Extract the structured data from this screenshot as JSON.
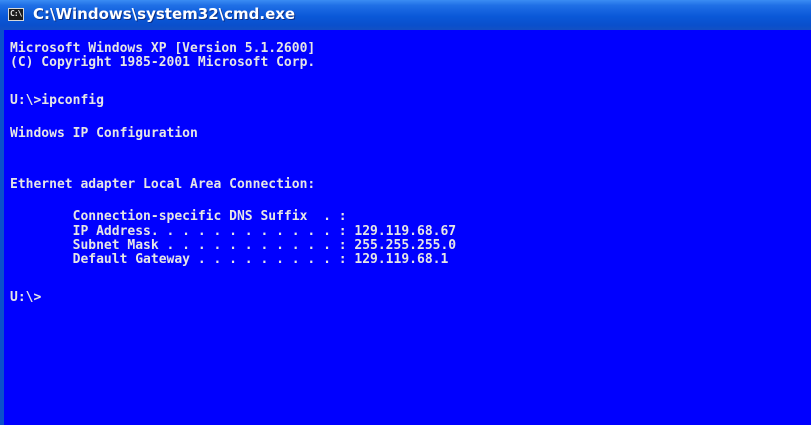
{
  "window": {
    "title": "C:\\Windows\\system32\\cmd.exe",
    "icon": "cmd-icon",
    "icon_text": "C:\\"
  },
  "console": {
    "lines": [
      "Microsoft Windows XP [Version 5.1.2600]",
      "(C) Copyright 1985-2001 Microsoft Corp.",
      "U:\\>ipconfig",
      "Windows IP Configuration",
      "Ethernet adapter Local Area Connection:",
      "        Connection-specific DNS Suffix  . :",
      "        IP Address. . . . . . . . . . . . : 129.119.68.67",
      "        Subnet Mask . . . . . . . . . . . : 255.255.255.0",
      "        Default Gateway . . . . . . . . . : 129.119.68.1",
      "U:\\>"
    ]
  },
  "colors": {
    "console_background": "#0000ff",
    "console_text": "#e6e6e6",
    "titlebar": "#0a58d8"
  }
}
